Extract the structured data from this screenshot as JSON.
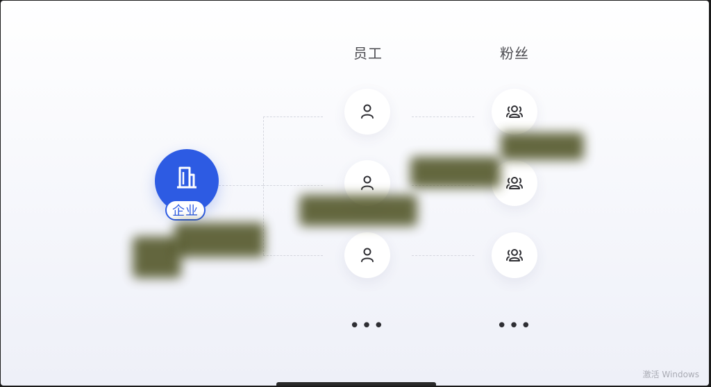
{
  "columns": {
    "staff_title": "员工",
    "fans_title": "粉丝"
  },
  "enterprise": {
    "label": "企业",
    "icon": "building-icon",
    "color": "#2d5be3"
  },
  "staff_nodes": [
    "person-icon",
    "person-icon",
    "person-icon"
  ],
  "fan_nodes": [
    "group-icon",
    "group-icon",
    "group-icon"
  ],
  "more": {
    "staff": "•••",
    "fans": "•••"
  },
  "watermark": "激活 Windows"
}
